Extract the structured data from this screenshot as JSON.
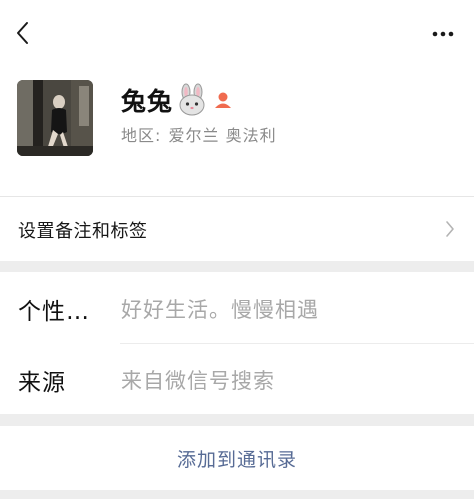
{
  "profile": {
    "name": "兔兔",
    "region_label": "地区:",
    "region_value": "爱尔兰 奥法利"
  },
  "remark_row": {
    "label": "设置备注和标签"
  },
  "info": {
    "signature_label": "个性…",
    "signature_value": "好好生活。慢慢相遇",
    "source_label": "来源",
    "source_value": "来自微信号搜索"
  },
  "actions": {
    "add_contact_label": "添加到通讯录"
  },
  "colors": {
    "link": "#576b95",
    "gender_female": "#f06b4f",
    "page_bg": "#ededed"
  }
}
